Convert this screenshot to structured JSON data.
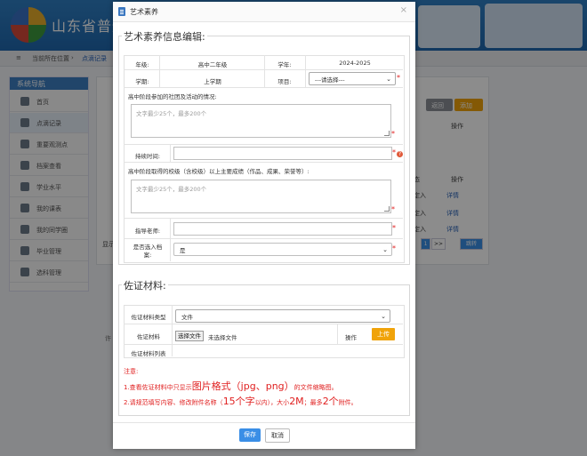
{
  "background": {
    "site_title": "山东省普通",
    "breadcrumb": {
      "label": "当前所在位置",
      "current": "点滴记录"
    },
    "sidebar": {
      "title": "系统导航",
      "items": [
        "首页",
        "点滴记录",
        "重要观测点",
        "档案查看",
        "学业水平",
        "我的课表",
        "我的同学圈",
        "毕业管理",
        "选科管理"
      ]
    },
    "buttons": {
      "back": "返回",
      "add": "添加"
    },
    "table": {
      "op_header": "操作",
      "col_partial": "态",
      "rows": [
        {
          "status": "定入",
          "link": "详情"
        },
        {
          "status": "定入",
          "link": "详情"
        },
        {
          "status": "定入",
          "link": "详情"
        }
      ]
    },
    "pager": {
      "page": "1",
      "next": ">>",
      "jump": "跳转",
      "show": "显示"
    },
    "footer_partial": "许"
  },
  "modal": {
    "title": "艺术素养",
    "section1": {
      "legend": "艺术素养信息编辑:",
      "grade_label": "年级:",
      "grade_value": "高中二年级",
      "year_label": "学年:",
      "year_value": "2024-2025",
      "term_label": "学期:",
      "term_value": "上学期",
      "item_label": "项目:",
      "item_value": "---请选择---",
      "activity_label": "高中阶段参加的社团及活动的情况:",
      "activity_placeholder": "文字最少25个，最多200个",
      "duration_label": "持续时间:",
      "award_label": "高中阶段取得的校级（含校级）以上主要成绩（作品、成果、荣誉等）:",
      "award_placeholder": "文字最少25个，最多200个",
      "teacher_label": "指导老师:",
      "archive_label_1": "是否选入档",
      "archive_label_2": "案:",
      "archive_value": "是"
    },
    "section2": {
      "legend": "佐证材料:",
      "type_label": "佐证材料类型",
      "type_value": "文件",
      "file_label": "佐证材料",
      "choose_file": "选择文件",
      "no_file": "未选择文件",
      "op_label": "操作",
      "upload": "上传",
      "list_label": "佐证材料列表",
      "note_title": "注意:",
      "note1_a": "1.查看佐证材料中只显示",
      "note1_b": "图片格式（jpg、png）",
      "note1_c": "的文件缩略图。",
      "note2_a": "2.请规范填写内容、修改附件名称（",
      "note2_b": "15个字",
      "note2_c": "以内），大小",
      "note2_d": "2M",
      "note2_e": "；最多",
      "note2_f": "2个",
      "note2_g": "附件。"
    },
    "save": "保存",
    "cancel": "取消"
  },
  "colors": {
    "primary": "#3a8ee6",
    "required": "#e02020",
    "upload": "#f0a30a",
    "header": "#2f7fc4"
  }
}
